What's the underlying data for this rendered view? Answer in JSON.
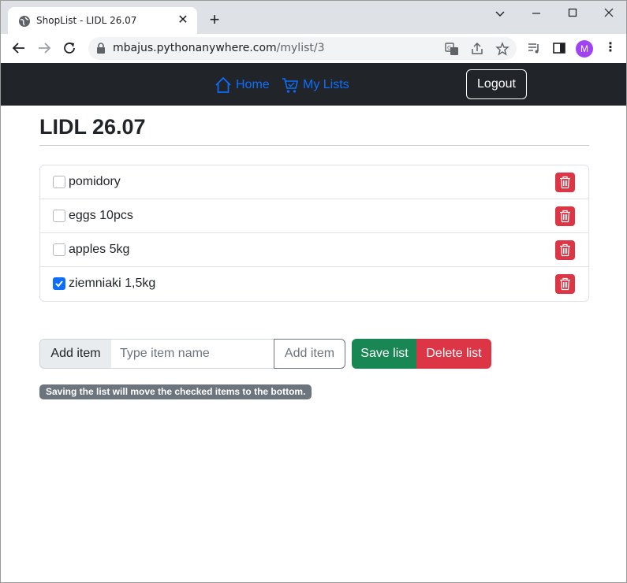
{
  "browser": {
    "tab_title": "ShopList - LIDL 26.07",
    "url_host": "mbajus.pythonanywhere.com",
    "url_path": "/mylist/3",
    "profile_initial": "M"
  },
  "navbar": {
    "home_label": "Home",
    "mylists_label": "My Lists",
    "logout_label": "Logout"
  },
  "page": {
    "title": "LIDL 26.07"
  },
  "items": [
    {
      "label": "pomidory",
      "checked": false
    },
    {
      "label": "eggs 10pcs",
      "checked": false
    },
    {
      "label": "apples 5kg",
      "checked": false
    },
    {
      "label": "ziemniaki 1,5kg",
      "checked": true
    }
  ],
  "add_form": {
    "label": "Add item",
    "placeholder": "Type item name",
    "button_label": "Add item"
  },
  "actions": {
    "save_label": "Save list",
    "delete_label": "Delete list"
  },
  "hint": "Saving the list will move the checked items to the bottom.",
  "colors": {
    "navbar_bg": "#212529",
    "link": "#0d6efd",
    "success": "#198754",
    "danger": "#dc3545",
    "secondary": "#6c757d"
  }
}
